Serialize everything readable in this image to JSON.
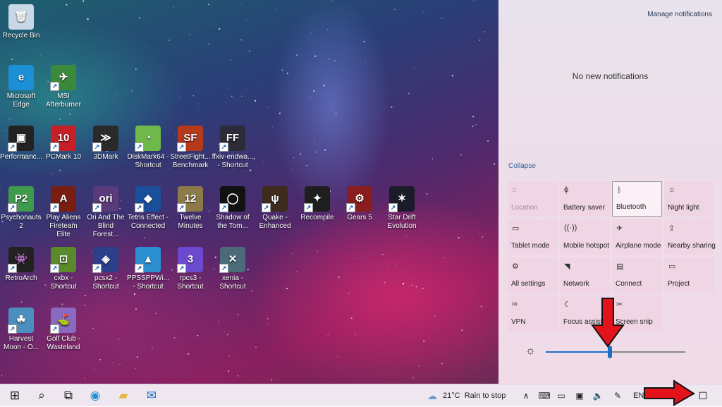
{
  "desktop_icons": [
    {
      "label": "Recycle Bin",
      "icon": "recycle-bin-icon",
      "glyph": "🗑",
      "bg": "#c9d8e6",
      "col": 0,
      "row": 0,
      "shortcut": false
    },
    {
      "label": "Microsoft Edge",
      "icon": "edge-icon",
      "glyph": "e",
      "bg": "#1c8fd6",
      "col": 0,
      "row": 1,
      "shortcut": false
    },
    {
      "label": "MSI Afterburner",
      "icon": "msi-afterburner-icon",
      "glyph": "✈",
      "bg": "#3b8a3a",
      "col": 1,
      "row": 1,
      "shortcut": true
    },
    {
      "label": "Performanc...",
      "icon": "performance-icon",
      "glyph": "▣",
      "bg": "#222222",
      "col": 0,
      "row": 2,
      "shortcut": true
    },
    {
      "label": "PCMark 10",
      "icon": "pcmark-icon",
      "glyph": "10",
      "bg": "#c42026",
      "col": 1,
      "row": 2,
      "shortcut": true
    },
    {
      "label": "3DMark",
      "icon": "3dmark-icon",
      "glyph": "≫",
      "bg": "#2a2a2a",
      "col": 2,
      "row": 2,
      "shortcut": true
    },
    {
      "label": "DiskMark64 - Shortcut",
      "icon": "diskmark-icon",
      "glyph": "◔",
      "bg": "#6fb84a",
      "col": 3,
      "row": 2,
      "shortcut": true
    },
    {
      "label": "StreetFight... Benchmark",
      "icon": "streetfighter-icon",
      "glyph": "SF",
      "bg": "#b33a1b",
      "col": 4,
      "row": 2,
      "shortcut": true
    },
    {
      "label": "ffxiv-endwa... - Shortcut",
      "icon": "ffxiv-icon",
      "glyph": "FF",
      "bg": "#2b2b3a",
      "col": 5,
      "row": 2,
      "shortcut": true
    },
    {
      "label": "Psychonauts 2",
      "icon": "psychonauts-icon",
      "glyph": "P2",
      "bg": "#3f9b4c",
      "col": 0,
      "row": 3,
      "shortcut": true
    },
    {
      "label": "Play Aliens Fireteam Elite",
      "icon": "aliens-icon",
      "glyph": "A",
      "bg": "#7a1d12",
      "col": 1,
      "row": 3,
      "shortcut": true
    },
    {
      "label": "Ori And The Blind Forest...",
      "icon": "ori-icon",
      "glyph": "ori",
      "bg": "#5a3a7a",
      "col": 2,
      "row": 3,
      "shortcut": true
    },
    {
      "label": "Tetris Effect - Connected",
      "icon": "tetris-icon",
      "glyph": "◆",
      "bg": "#1a4f9c",
      "col": 3,
      "row": 3,
      "shortcut": true
    },
    {
      "label": "Twelve Minutes",
      "icon": "twelve-minutes-icon",
      "glyph": "12",
      "bg": "#8c7a4a",
      "col": 4,
      "row": 3,
      "shortcut": true
    },
    {
      "label": "Shadow of the Tom...",
      "icon": "shadow-tomb-icon",
      "glyph": "◯",
      "bg": "#111111",
      "col": 5,
      "row": 3,
      "shortcut": true
    },
    {
      "label": "Quake - Enhanced",
      "icon": "quake-icon",
      "glyph": "ψ",
      "bg": "#3d2b1e",
      "col": 6,
      "row": 3,
      "shortcut": true
    },
    {
      "label": "Recompile",
      "icon": "recompile-icon",
      "glyph": "✦",
      "bg": "#1e1e1e",
      "col": 7,
      "row": 3,
      "shortcut": true
    },
    {
      "label": "Gears 5",
      "icon": "gears5-icon",
      "glyph": "⚙",
      "bg": "#8a1d1d",
      "col": 8,
      "row": 3,
      "shortcut": true
    },
    {
      "label": "Star Drift Evolution",
      "icon": "star-drift-icon",
      "glyph": "✶",
      "bg": "#1b1b2a",
      "col": 9,
      "row": 3,
      "shortcut": true
    },
    {
      "label": "RetroArch",
      "icon": "retroarch-icon",
      "glyph": "👾",
      "bg": "#222222",
      "col": 0,
      "row": 4,
      "shortcut": true
    },
    {
      "label": "cxbx - Shortcut",
      "icon": "cxbx-icon",
      "glyph": "⊡",
      "bg": "#5a8a2a",
      "col": 1,
      "row": 4,
      "shortcut": true
    },
    {
      "label": "pcsx2 - Shortcut",
      "icon": "pcsx2-icon",
      "glyph": "◈",
      "bg": "#2c3f8a",
      "col": 2,
      "row": 4,
      "shortcut": true
    },
    {
      "label": "PPSSPPWi... - Shortcut",
      "icon": "ppsspp-icon",
      "glyph": "▲",
      "bg": "#2b8fd0",
      "col": 3,
      "row": 4,
      "shortcut": true
    },
    {
      "label": "rpcs3 - Shortcut",
      "icon": "rpcs3-icon",
      "glyph": "3",
      "bg": "#6b4ad0",
      "col": 4,
      "row": 4,
      "shortcut": true
    },
    {
      "label": "xenia - Shortcut",
      "icon": "xenia-icon",
      "glyph": "✕",
      "bg": "#4b6a7a",
      "col": 5,
      "row": 4,
      "shortcut": true
    },
    {
      "label": "Harvest Moon - O...",
      "icon": "harvest-moon-icon",
      "glyph": "☘",
      "bg": "#4a8fc0",
      "col": 0,
      "row": 5,
      "shortcut": true
    },
    {
      "label": "Golf Club - Wasteland",
      "icon": "golf-club-icon",
      "glyph": "⛳",
      "bg": "#8a6ac0",
      "col": 1,
      "row": 5,
      "shortcut": true
    }
  ],
  "action_center": {
    "manage_label": "Manage notifications",
    "no_notifications": "No new notifications",
    "collapse_label": "Collapse",
    "tiles": [
      {
        "label": "Location",
        "icon": "location-icon",
        "glyph": "⌂",
        "state": "disabled"
      },
      {
        "label": "Battery saver",
        "icon": "battery-saver-icon",
        "glyph": "ϕ",
        "state": "off"
      },
      {
        "label": "Bluetooth",
        "icon": "bluetooth-icon",
        "glyph": "ᛒ",
        "state": "selected"
      },
      {
        "label": "Night light",
        "icon": "night-light-icon",
        "glyph": "☼",
        "state": "off"
      },
      {
        "label": "Tablet mode",
        "icon": "tablet-mode-icon",
        "glyph": "▭",
        "state": "off"
      },
      {
        "label": "Mobile hotspot",
        "icon": "mobile-hotspot-icon",
        "glyph": "((·))",
        "state": "off"
      },
      {
        "label": "Airplane mode",
        "icon": "airplane-icon",
        "glyph": "✈",
        "state": "off"
      },
      {
        "label": "Nearby sharing",
        "icon": "nearby-sharing-icon",
        "glyph": "⇪",
        "state": "off"
      },
      {
        "label": "All settings",
        "icon": "settings-icon",
        "glyph": "⚙",
        "state": "off"
      },
      {
        "label": "Network",
        "icon": "network-icon",
        "glyph": "◥",
        "state": "off"
      },
      {
        "label": "Connect",
        "icon": "connect-icon",
        "glyph": "▤",
        "state": "off"
      },
      {
        "label": "Project",
        "icon": "project-icon",
        "glyph": "▭",
        "state": "off"
      },
      {
        "label": "VPN",
        "icon": "vpn-icon",
        "glyph": "∞",
        "state": "off"
      },
      {
        "label": "Focus assist",
        "icon": "focus-assist-icon",
        "glyph": "☾",
        "state": "off"
      },
      {
        "label": "Screen snip",
        "icon": "screen-snip-icon",
        "glyph": "✂",
        "state": "off"
      }
    ],
    "brightness": {
      "icon": "brightness-icon",
      "glyph": "☼",
      "level": 0.46
    }
  },
  "taskbar": {
    "apps": [
      {
        "icon": "windows-start-icon",
        "glyph": "⊞",
        "color": "#1a1a1a"
      },
      {
        "icon": "search-icon",
        "glyph": "⌕",
        "color": "#222222"
      },
      {
        "icon": "task-view-icon",
        "glyph": "⧉",
        "color": "#222222"
      },
      {
        "icon": "edge-icon",
        "glyph": "◉",
        "color": "#1c8fd6"
      },
      {
        "icon": "file-explorer-icon",
        "glyph": "▰",
        "color": "#e8b73a"
      },
      {
        "icon": "mail-icon",
        "glyph": "✉",
        "color": "#1a6fc9"
      }
    ],
    "weather_icon": "weather-cloud-icon",
    "weather_glyph": "☁",
    "weather_text": "21°C  Rain to stop",
    "tray_icons": [
      {
        "icon": "chevron-up-icon",
        "glyph": "∧"
      },
      {
        "icon": "meet-now-icon",
        "glyph": "⌨"
      },
      {
        "icon": "battery-icon",
        "glyph": "▭"
      },
      {
        "icon": "network-icon",
        "glyph": "▣"
      },
      {
        "icon": "volume-icon",
        "glyph": "🔈"
      },
      {
        "icon": "pen-icon",
        "glyph": "✎"
      }
    ],
    "language": "ENG",
    "notification_icon": "notification-icon",
    "notification_glyph": "☐"
  },
  "colors": {
    "accent": "#1a6fc9",
    "annotation_arrow": "#e3131b"
  }
}
